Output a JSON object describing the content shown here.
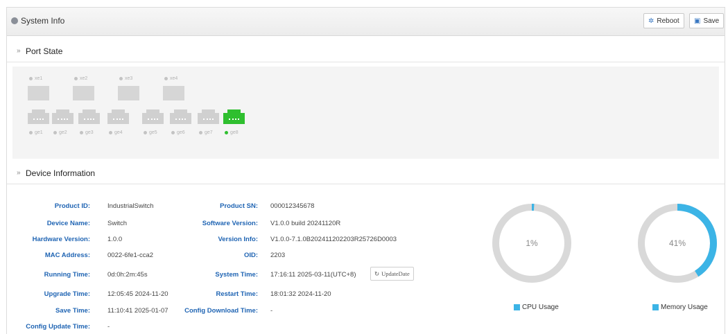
{
  "header": {
    "title": "System Info",
    "reboot_label": "Reboot",
    "save_label": "Save"
  },
  "port_state": {
    "title": "Port State",
    "top_ports": [
      {
        "label": "xe1",
        "status": "down"
      },
      {
        "label": "xe2",
        "status": "down"
      },
      {
        "label": "xe3",
        "status": "down"
      },
      {
        "label": "xe4",
        "status": "down"
      }
    ],
    "bottom_ports": [
      {
        "label": "ge1",
        "status": "down"
      },
      {
        "label": "ge2",
        "status": "down"
      },
      {
        "label": "ge3",
        "status": "down"
      },
      {
        "label": "ge4",
        "status": "down"
      },
      {
        "label": "ge5",
        "status": "down"
      },
      {
        "label": "ge6",
        "status": "down"
      },
      {
        "label": "ge7",
        "status": "down"
      },
      {
        "label": "ge8",
        "status": "up"
      }
    ],
    "colors": {
      "up": "#2fbf2f",
      "down": "#d0d0d0"
    }
  },
  "device_info": {
    "title": "Device Information",
    "left": [
      {
        "key": "Product ID:",
        "value": "IndustrialSwitch"
      },
      {
        "key": "Device Name:",
        "value": "Switch"
      },
      {
        "key": "Hardware Version:",
        "value": "1.0.0"
      },
      {
        "key": "MAC Address:",
        "value": "0022-6fe1-cca2"
      },
      {
        "key": "Running Time:",
        "value": "0d:0h:2m:45s"
      },
      {
        "key": "Upgrade Time:",
        "value": "12:05:45 2024-11-20"
      },
      {
        "key": "Save Time:",
        "value": "11:10:41 2025-01-07"
      },
      {
        "key": "Config Update Time:",
        "value": "-"
      }
    ],
    "right": [
      {
        "key": "Product SN:",
        "value": "000012345678"
      },
      {
        "key": "Software Version:",
        "value": "V1.0.0 build 20241120R"
      },
      {
        "key": "Version Info:",
        "value": "V1.0.0-7.1.0B202411202203R25726D0003"
      },
      {
        "key": "OID:",
        "value": "2203"
      },
      {
        "key": "System Time:",
        "value": "17:16:11 2025-03-11(UTC+8)"
      },
      {
        "key": "Restart Time:",
        "value": "18:01:32 2024-11-20"
      },
      {
        "key": "Config Download Time:",
        "value": "-"
      }
    ],
    "update_date_label": "UpdateDate"
  },
  "usage": {
    "cpu": {
      "value_text": "1%",
      "fraction": 0.01,
      "label": "CPU Usage"
    },
    "memory": {
      "value_text": "41%",
      "fraction": 0.41,
      "label": "Memory Usage"
    },
    "colors": {
      "used": "#3cb4e6",
      "track": "#d9d9d9"
    }
  }
}
